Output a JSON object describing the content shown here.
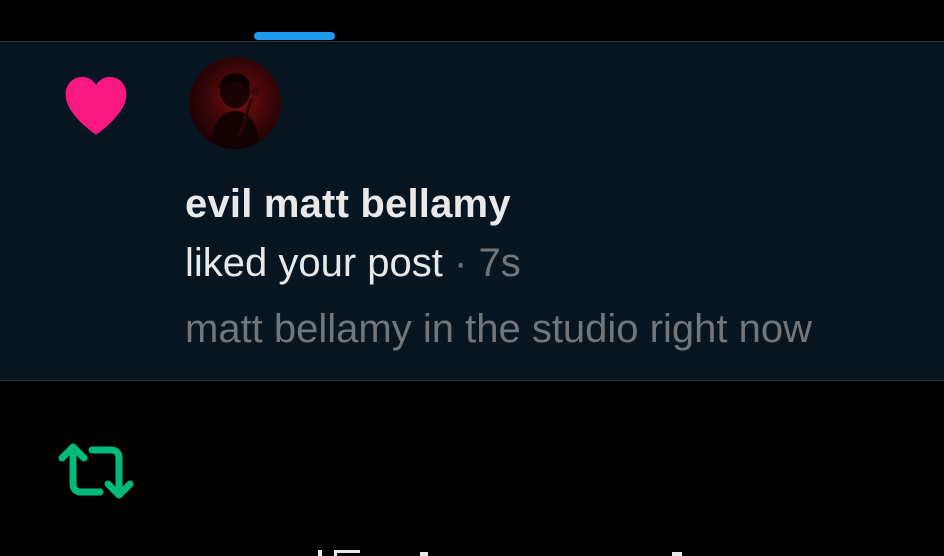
{
  "tabs": {
    "active_indicator_color": "#1d9bf0"
  },
  "notification": {
    "type_icon": "heart-icon",
    "icon_color": "#f91880",
    "avatar": "user-avatar",
    "user_name": "evil matt bellamy",
    "action_text": "liked your post",
    "separator": "·",
    "timestamp": "7s",
    "post_preview": "matt bellamy in the studio right now"
  },
  "next_notification": {
    "type_icon": "retweet-icon",
    "icon_color": "#00ba7c"
  },
  "colors": {
    "background": "#000000",
    "unread_background": "#071520",
    "primary_text": "#e7e9ea",
    "secondary_text": "#71767b"
  }
}
